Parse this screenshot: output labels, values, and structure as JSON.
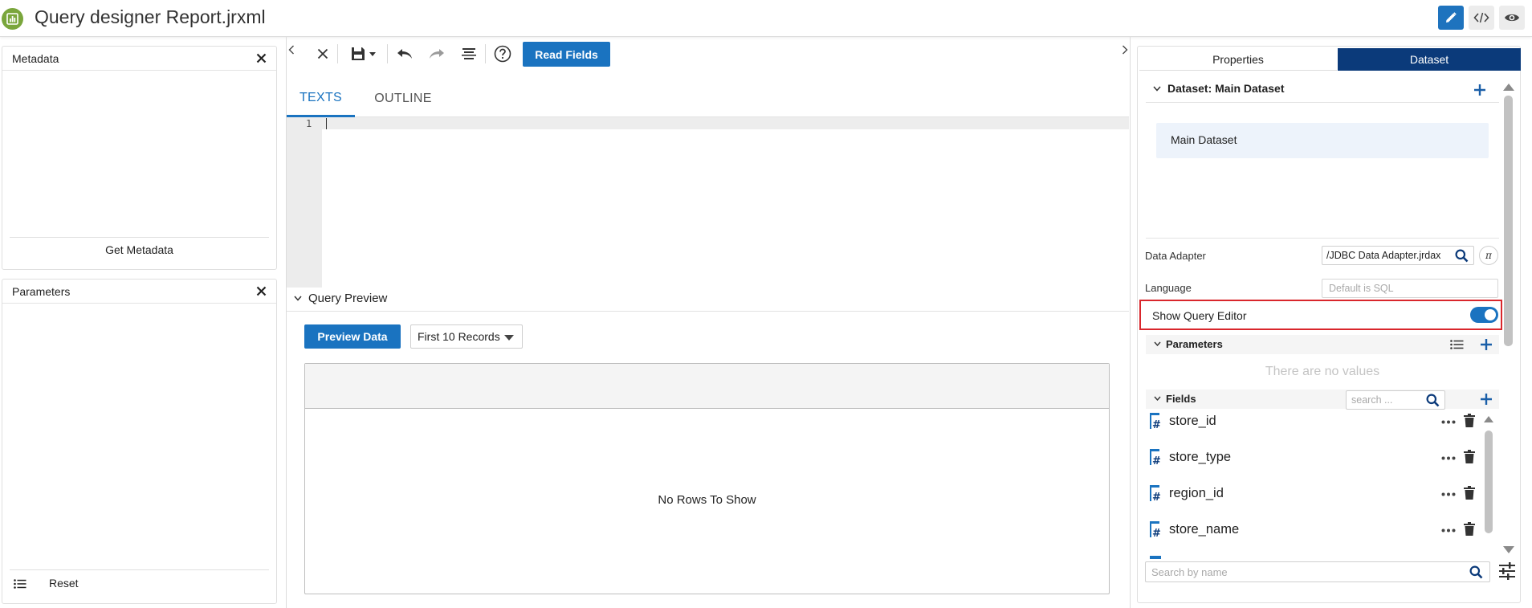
{
  "window": {
    "title": "Query designer Report.jrxml"
  },
  "metadata_panel": {
    "title": "Metadata",
    "action_label": "Get Metadata"
  },
  "parameters_panel": {
    "title": "Parameters",
    "reset_label": "Reset"
  },
  "toolbar": {
    "read_fields_label": "Read Fields"
  },
  "editor": {
    "tabs": [
      {
        "label": "TEXTS",
        "selected": true
      },
      {
        "label": "OUTLINE",
        "selected": false
      }
    ],
    "line_numbers": [
      "1"
    ]
  },
  "query_preview": {
    "title": "Query Preview",
    "preview_label": "Preview Data",
    "records_selected": "First 10 Records",
    "empty_text": "No Rows To Show"
  },
  "right_panel": {
    "tabs": [
      {
        "label": "Properties",
        "selected": false
      },
      {
        "label": "Dataset",
        "selected": true
      }
    ],
    "dataset_header": "Dataset: Main Dataset",
    "datasets": [
      "Main Dataset"
    ],
    "data_adapter": {
      "label": "Data Adapter",
      "value": "/JDBC Data Adapter.jrdax",
      "expr_label": "π"
    },
    "language": {
      "label": "Language",
      "placeholder": "Default is SQL"
    },
    "show_query_editor": {
      "label": "Show Query Editor",
      "on": true
    },
    "parameters": {
      "title": "Parameters",
      "empty_text": "There are no values"
    },
    "fields": {
      "title": "Fields",
      "search_placeholder": "search ...",
      "items": [
        "store_id",
        "store_type",
        "region_id",
        "store_name"
      ]
    },
    "search_by_name_placeholder": "Search by name"
  },
  "colors": {
    "accent": "#1a73c0",
    "dataset_tab": "#0b3a7a",
    "highlight_border": "#d9262c",
    "logo": "#7aa63c"
  }
}
